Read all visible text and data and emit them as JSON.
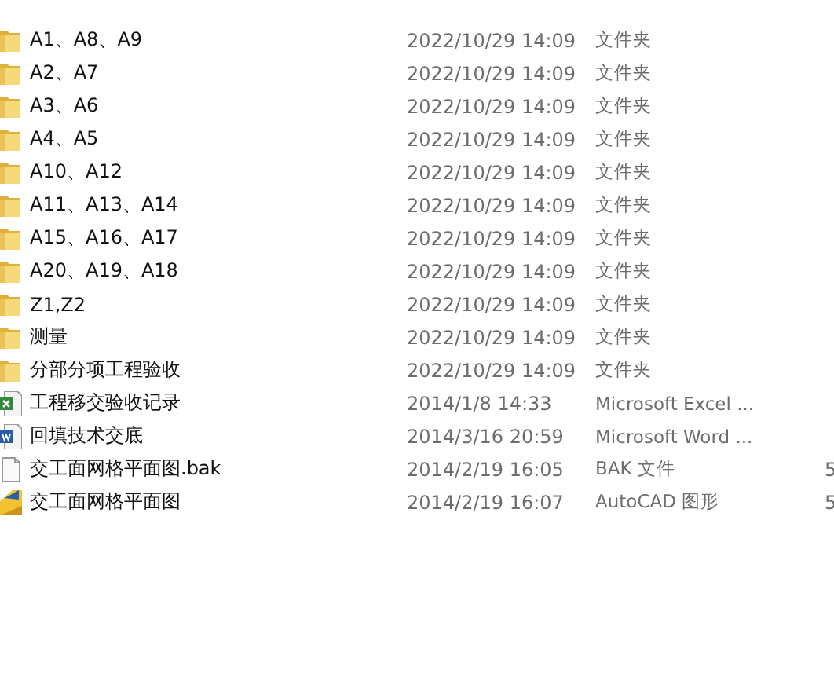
{
  "files": [
    {
      "kind": "folder",
      "name": "A1、A8、A9",
      "date": "2022/10/29 14:09",
      "type": "文件夹"
    },
    {
      "kind": "folder",
      "name": "A2、A7",
      "date": "2022/10/29 14:09",
      "type": "文件夹"
    },
    {
      "kind": "folder",
      "name": "A3、A6",
      "date": "2022/10/29 14:09",
      "type": "文件夹"
    },
    {
      "kind": "folder",
      "name": "A4、A5",
      "date": "2022/10/29 14:09",
      "type": "文件夹"
    },
    {
      "kind": "folder",
      "name": "A10、A12",
      "date": "2022/10/29 14:09",
      "type": "文件夹"
    },
    {
      "kind": "folder",
      "name": "A11、A13、A14",
      "date": "2022/10/29 14:09",
      "type": "文件夹"
    },
    {
      "kind": "folder",
      "name": "A15、A16、A17",
      "date": "2022/10/29 14:09",
      "type": "文件夹"
    },
    {
      "kind": "folder",
      "name": "A20、A19、A18",
      "date": "2022/10/29 14:09",
      "type": "文件夹"
    },
    {
      "kind": "folder",
      "name": "Z1,Z2",
      "date": "2022/10/29 14:09",
      "type": "文件夹"
    },
    {
      "kind": "folder",
      "name": "测量",
      "date": "2022/10/29 14:09",
      "type": "文件夹"
    },
    {
      "kind": "folder",
      "name": "分部分项工程验收",
      "date": "2022/10/29 14:09",
      "type": "文件夹"
    },
    {
      "kind": "excel",
      "name": "工程移交验收记录",
      "date": "2014/1/8 14:33",
      "type": "Microsoft Excel ..."
    },
    {
      "kind": "word",
      "name": "回填技术交底",
      "date": "2014/3/16 20:59",
      "type": "Microsoft Word ..."
    },
    {
      "kind": "blank",
      "name": "交工面网格平面图.bak",
      "date": "2014/2/19 16:05",
      "type": "BAK 文件",
      "column_4": "5"
    },
    {
      "kind": "cad",
      "name": "交工面网格平面图",
      "date": "2014/2/19 16:07",
      "type": "AutoCAD 图形",
      "column_4": "5"
    }
  ]
}
